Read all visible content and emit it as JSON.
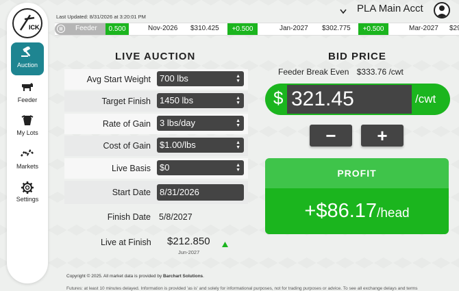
{
  "header": {
    "last_updated": "Last Updated: 8/31/2026 at 3:20:01 PM",
    "account": "PLA Main Acct"
  },
  "sidebar": {
    "logo_text": "ICK",
    "items": [
      {
        "label": "Auction",
        "icon": "gavel-icon"
      },
      {
        "label": "Feeder",
        "icon": "cow-icon"
      },
      {
        "label": "My Lots",
        "icon": "lots-icon"
      },
      {
        "label": "Markets",
        "icon": "markets-icon"
      },
      {
        "label": "Settings",
        "icon": "gear-icon"
      }
    ]
  },
  "ticker": {
    "feeder_label": "Feeder",
    "feeder_change": "0.500",
    "items": [
      {
        "month": "Nov-2026",
        "price": "$310.425",
        "change": "+0.500"
      },
      {
        "month": "Jan-2027",
        "price": "$302.775",
        "change": "+0.500"
      },
      {
        "month": "Mar-2027",
        "price": "$29"
      }
    ]
  },
  "auction": {
    "title": "LIVE AUCTION",
    "fields": [
      {
        "label": "Avg Start Weight",
        "value": "700 lbs"
      },
      {
        "label": "Target Finish",
        "value": "1450 lbs"
      },
      {
        "label": "Rate of Gain",
        "value": "3 lbs/day"
      },
      {
        "label": "Cost of Gain",
        "value": "$1.00/lbs"
      },
      {
        "label": "Live Basis",
        "value": "$0"
      },
      {
        "label": "Start Date",
        "value": "8/31/2026"
      },
      {
        "label": "Finish Date",
        "value": "5/8/2027"
      }
    ],
    "live_finish_label": "Live at Finish",
    "live_finish_price": "$212.850",
    "live_finish_month": "Jun-2027"
  },
  "bid": {
    "title": "BID PRICE",
    "break_even_label": "Feeder Break Even",
    "break_even_value": "$333.76 /cwt",
    "currency": "$",
    "price": "321.45",
    "unit": "/cwt",
    "minus": "−",
    "plus": "+"
  },
  "profit": {
    "label": "PROFIT",
    "value": "+$86.17",
    "unit": "/head"
  },
  "footer": {
    "copyright": "Copyright © 2025. All market data is provided by ",
    "provider": "Barchart Solutions",
    "period": ".",
    "disclaimer": "Futures: at least 10 minutes delayed. Information is provided 'as is' and solely for informational purposes, not for trading purposes or advice. To see all exchange delays and terms"
  },
  "colors": {
    "accent_teal": "#1e8591",
    "green": "#1bb51e",
    "dark_input": "#444444"
  }
}
